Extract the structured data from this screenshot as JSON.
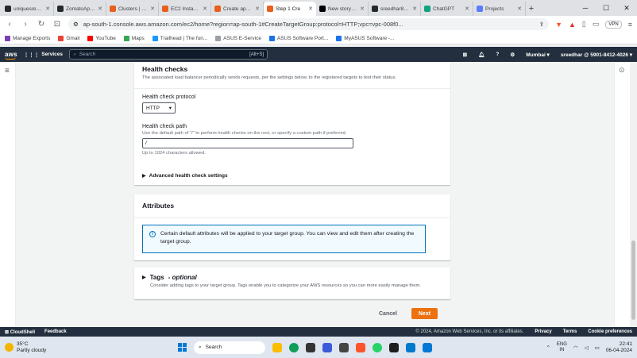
{
  "browser": {
    "tabs": [
      {
        "label": "uniquesreedhar",
        "color": "#24292f"
      },
      {
        "label": "ZomatoApp-C",
        "color": "#24292f"
      },
      {
        "label": "Clusters | Elasti",
        "color": "#e8601c"
      },
      {
        "label": "EC2 Instance C",
        "color": "#e8601c"
      },
      {
        "label": "Create applicat",
        "color": "#e8601c"
      },
      {
        "label": "Step 1 Cre",
        "color": "#e8601c",
        "active": true
      },
      {
        "label": "New story – M",
        "color": "#000000"
      },
      {
        "label": "sreedhar8897/",
        "color": "#24292f"
      },
      {
        "label": "ChatGPT",
        "color": "#10a37f"
      },
      {
        "label": "Projects",
        "color": "#5b7cfa"
      }
    ],
    "url": "ap-south-1.console.aws.amazon.com/ec2/home?region=ap-south-1#CreateTargetGroup:protocol=HTTP;vpc=vpc-008f0...",
    "vpn_label": "VPN",
    "bookmarks": [
      {
        "label": "Manage Exports",
        "color": "#7b3fb3"
      },
      {
        "label": "Gmail",
        "color": "#ea4335"
      },
      {
        "label": "YouTube",
        "color": "#ff0000"
      },
      {
        "label": "Maps",
        "color": "#34a853"
      },
      {
        "label": "Trailhead | The fun...",
        "color": "#1b96ff"
      },
      {
        "label": "ASUS E-Service",
        "color": "#9aa0a6"
      },
      {
        "label": "ASUS Software Port...",
        "color": "#1a73e8"
      },
      {
        "label": "MyASUS Software -...",
        "color": "#1a73e8"
      }
    ]
  },
  "aws_nav": {
    "logo": "aws",
    "services_label": "Services",
    "search_placeholder": "Search",
    "search_shortcut": "[Alt+S]",
    "region": "Mumbai ▾",
    "account": "sreedhar @ 5901-8412-4026 ▾"
  },
  "health_checks": {
    "title": "Health checks",
    "description": "The associated load balancer periodically sends requests, per the settings below, to the registered targets to test their status.",
    "protocol_label": "Health check protocol",
    "protocol_value": "HTTP",
    "path_label": "Health check path",
    "path_description": "Use the default path of \"/\" to perform health checks on the root, or specify a custom path if preferred.",
    "path_value": "/",
    "path_constraint": "Up to 1024 characters allowed.",
    "advanced_label": "Advanced health check settings"
  },
  "attributes": {
    "title": "Attributes",
    "info_text": "Certain default attributes will be applied to your target group. You can view and edit them after creating the target group."
  },
  "tags": {
    "title": "Tags",
    "optional": "- optional",
    "description": "Consider adding tags to your target group. Tags enable you to categorize your AWS resources so you can more easily manage them."
  },
  "actions": {
    "cancel": "Cancel",
    "next": "Next"
  },
  "footer": {
    "cloudshell": "CloudShell",
    "feedback": "Feedback",
    "copyright": "© 2024, Amazon Web Services, Inc. or its affiliates.",
    "privacy": "Privacy",
    "terms": "Terms",
    "cookies": "Cookie preferences"
  },
  "taskbar": {
    "temp": "35°C",
    "weather": "Partly cloudy",
    "search_label": "Search",
    "lang1": "ENG",
    "lang2": "IN",
    "time": "22:41",
    "date": "06-04-2024"
  }
}
